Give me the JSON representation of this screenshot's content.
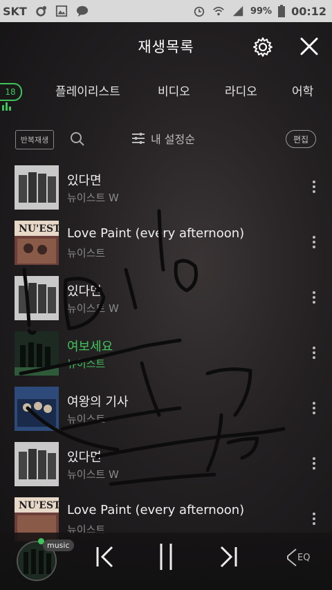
{
  "status_bar": {
    "carrier": "SKT",
    "battery": "99%",
    "time": "00:12"
  },
  "header": {
    "title": "재생목록"
  },
  "tabs": {
    "count": "18",
    "items": [
      "플레이리스트",
      "비디오",
      "라디오",
      "어학"
    ]
  },
  "toolbar": {
    "repeat_label": "반복재생",
    "sort_label": "내 설정순",
    "edit_label": "편집"
  },
  "songs": [
    {
      "title": "있다면",
      "artist": "뉴이스트 W"
    },
    {
      "title": "Love Paint (every afternoon)",
      "artist": "뉴이스트"
    },
    {
      "title": "있다면",
      "artist": "뉴이스트 W"
    },
    {
      "title": "여보세요",
      "artist": "뉴이스트",
      "playing": true
    },
    {
      "title": "여왕의 기사",
      "artist": "뉴이스트"
    },
    {
      "title": "있다면",
      "artist": "뉴이스트 W"
    },
    {
      "title": "Love Paint (every afternoon)",
      "artist": "뉴이스트"
    }
  ],
  "player": {
    "badge": "music",
    "eq_label": "EQ"
  },
  "colors": {
    "accent": "#3ec55a",
    "background": "#1b191a"
  }
}
